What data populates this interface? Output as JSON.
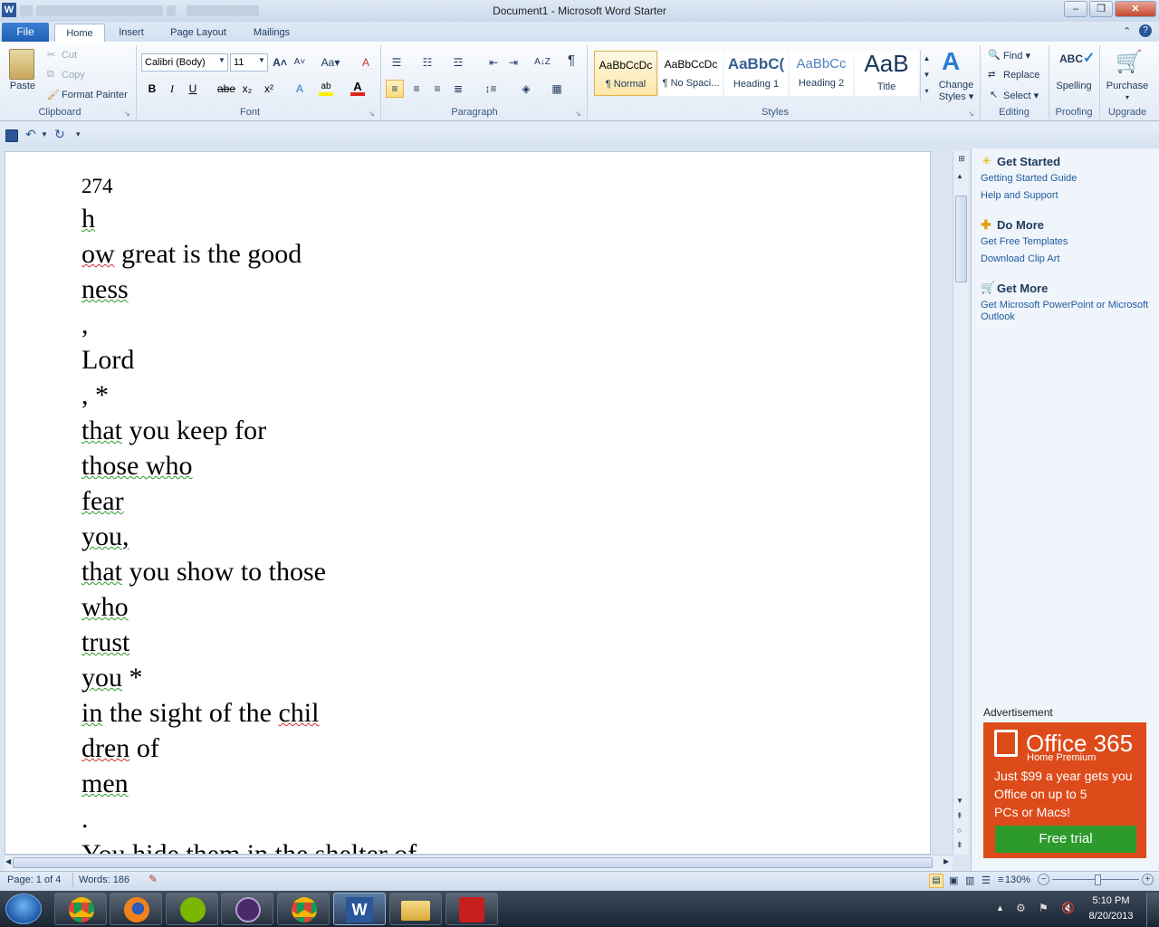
{
  "window": {
    "title": "Document1  -  Microsoft Word Starter",
    "minimize": "–",
    "restore": "❐",
    "close": "✕"
  },
  "tabs": {
    "file": "File",
    "home": "Home",
    "insert": "Insert",
    "page_layout": "Page Layout",
    "mailings": "Mailings"
  },
  "clipboard": {
    "paste": "Paste",
    "cut": "Cut",
    "copy": "Copy",
    "format_painter": "Format Painter",
    "group": "Clipboard"
  },
  "font": {
    "family": "Calibri (Body)",
    "size": "11",
    "group": "Font",
    "bold": "B",
    "italic": "I",
    "underline": "U",
    "strike": "abe",
    "subscript": "x₂",
    "superscript": "x²",
    "grow": "A˄",
    "shrink": "A˅",
    "case": "Aa▾",
    "clear": "A"
  },
  "paragraph": {
    "group": "Paragraph",
    "pilcrow": "¶",
    "sort": "A↓Z"
  },
  "styles": {
    "group": "Styles",
    "items": [
      {
        "sample": "AaBbCcDc",
        "name": "¶ Normal"
      },
      {
        "sample": "AaBbCcDc",
        "name": "¶ No Spaci..."
      },
      {
        "sample": "AaBbC(",
        "name": "Heading 1"
      },
      {
        "sample": "AaBbCc",
        "name": "Heading 2"
      },
      {
        "sample": "AaB",
        "name": "Title"
      }
    ],
    "change_styles": "Change Styles ▾"
  },
  "editing": {
    "group": "Editing",
    "find": "Find ▾",
    "replace": "Replace",
    "select": "Select ▾"
  },
  "proofing": {
    "group": "Proofing",
    "spelling": "Spelling"
  },
  "upgrade": {
    "group": "Upgrade",
    "purchase": "Purchase"
  },
  "document": {
    "lines": [
      "274",
      "h",
      "ow great is the good",
      "ness",
      ",",
      "Lord",
      ", *",
      "that you keep for",
      "those who",
      "fear",
      "you,",
      "that you show to those",
      "who",
      "trust",
      "you *",
      "in the sight of the chil",
      "dren of",
      "men",
      ".",
      "You hide them in the shelter of"
    ]
  },
  "pane": {
    "get_started": "Get Started",
    "getting_started_guide": "Getting Started Guide",
    "help_support": "Help and Support",
    "do_more": "Do More",
    "free_templates": "Get Free Templates",
    "clip_art": "Download Clip Art",
    "get_more": "Get More",
    "get_ms_1": "Get Microsoft PowerPoint or Microsoft",
    "get_ms_2": "Outlook",
    "ad_label": "Advertisement",
    "ad_title": "Office 365",
    "ad_sub": "Home Premium",
    "ad_line1": "Just $99 a year gets you",
    "ad_line2": "Office on up to 5",
    "ad_line3": "PCs or Macs!",
    "ad_button": "Free trial"
  },
  "status": {
    "page": "Page: 1 of 4",
    "words": "Words: 186",
    "zoom": "130%"
  },
  "clock": {
    "time": "5:10 PM",
    "date": "8/20/2013"
  },
  "colors": {
    "accent": "#2b579a",
    "ad": "#dd4b1a",
    "trial": "#2c9b2c"
  }
}
